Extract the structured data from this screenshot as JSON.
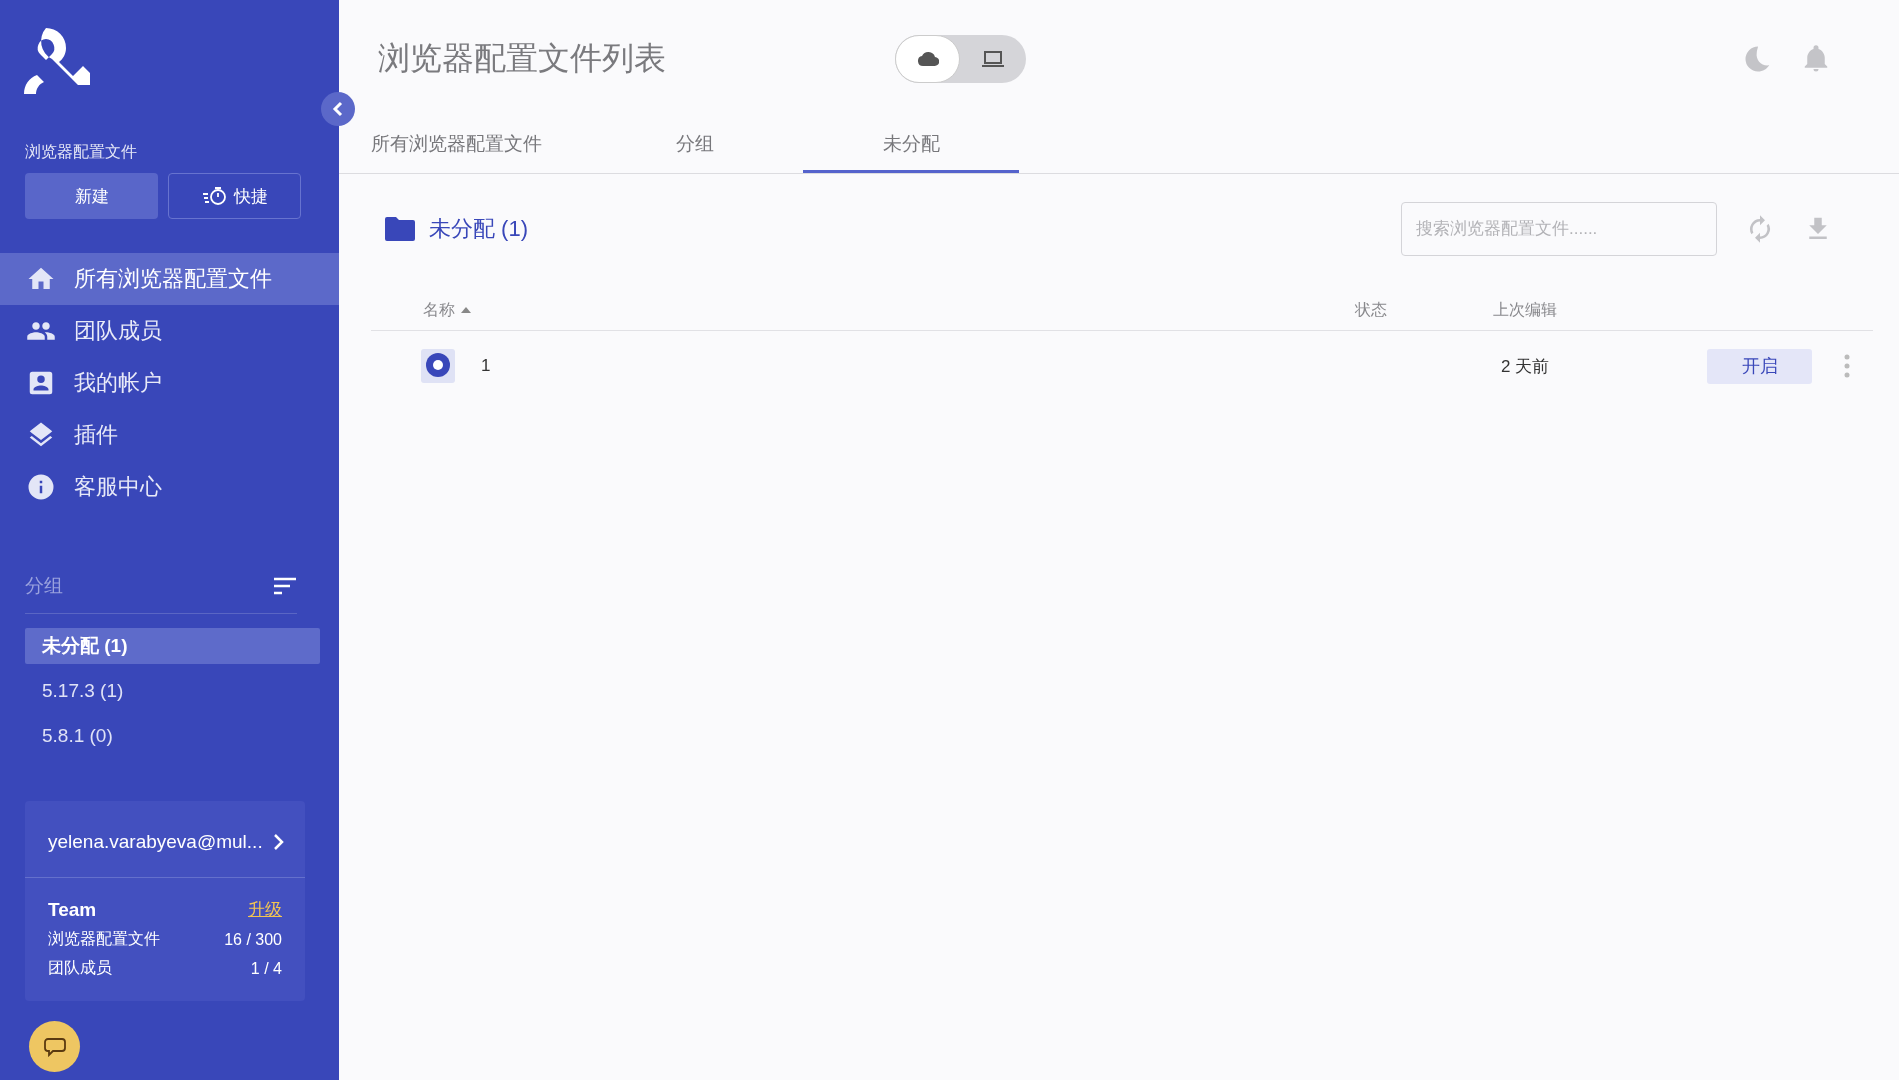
{
  "sidebar": {
    "section_label": "浏览器配置文件",
    "buttons": [
      {
        "label": "新建",
        "kind": "primary"
      },
      {
        "label": "快捷",
        "kind": "outline"
      }
    ],
    "nav": [
      {
        "label": "所有浏览器配置文件",
        "selected": true
      },
      {
        "label": "团队成员",
        "selected": false
      },
      {
        "label": "我的帐户",
        "selected": false
      },
      {
        "label": "插件",
        "selected": false
      },
      {
        "label": "客服中心",
        "selected": false
      }
    ],
    "groups_title": "分组",
    "groups": [
      {
        "label": "未分配 (1)",
        "selected": true
      },
      {
        "label": "5.17.3 (1)",
        "selected": false
      },
      {
        "label": "5.8.1 (0)",
        "selected": false
      }
    ],
    "account": {
      "email": "yelena.varabyeva@mul...",
      "plan": "Team",
      "upgrade": "升级",
      "quotas": [
        {
          "label": "浏览器配置文件",
          "value": "16 / 300"
        },
        {
          "label": "团队成员",
          "value": "1 / 4"
        }
      ]
    }
  },
  "header": {
    "title": "浏览器配置文件列表",
    "mode_toggle": [
      {
        "selected": true
      },
      {
        "selected": false
      }
    ]
  },
  "tabs": [
    {
      "label": "所有浏览器配置文件",
      "selected": false
    },
    {
      "label": "分组",
      "selected": false
    },
    {
      "label": "未分配",
      "selected": true
    }
  ],
  "folder": {
    "title": "未分配 (1)",
    "search": {
      "placeholder": "搜索浏览器配置文件......"
    }
  },
  "table": {
    "columns": [
      {
        "label": "名称",
        "sorted": true
      },
      {
        "label": "状态",
        "sorted": false
      },
      {
        "label": "上次编辑",
        "sorted": false
      }
    ],
    "rows": [
      {
        "name": "1",
        "last_edited": "2 天前",
        "action": "开启"
      }
    ]
  }
}
